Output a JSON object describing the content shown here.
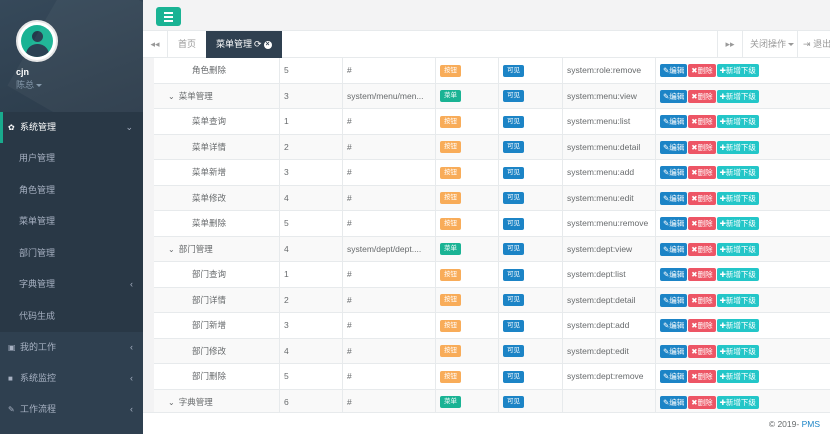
{
  "user": {
    "name": "cjn",
    "role": "陈总"
  },
  "sidebar": {
    "system_menu": {
      "label": "系统管理",
      "icon": "gear-icon"
    },
    "sub_items": [
      {
        "label": "用户管理"
      },
      {
        "label": "角色管理"
      },
      {
        "label": "菜单管理"
      },
      {
        "label": "部门管理"
      },
      {
        "label": "字典管理"
      },
      {
        "label": "代码生成"
      }
    ],
    "my_work": {
      "label": "我的工作",
      "icon": "briefcase-icon"
    },
    "monitor": {
      "label": "系统监控",
      "icon": "video-icon"
    },
    "workflow": {
      "label": "工作流程",
      "icon": "wrench-icon"
    }
  },
  "tabs": {
    "home": "首页",
    "active": "菜单管理",
    "close_ops": "关闭操作",
    "exit": "退出"
  },
  "table": {
    "rows": [
      {
        "name": "角色删除",
        "level": "child",
        "order": "5",
        "url": "#",
        "type": "按钮",
        "type_kind": "button",
        "visible": "可见",
        "perm": "system:role:remove"
      },
      {
        "name": "菜单管理",
        "level": "parent",
        "order": "3",
        "url": "system/menu/men...",
        "type": "菜单",
        "type_kind": "menu",
        "visible": "可见",
        "perm": "system:menu:view"
      },
      {
        "name": "菜单查询",
        "level": "child",
        "order": "1",
        "url": "#",
        "type": "按钮",
        "type_kind": "button",
        "visible": "可见",
        "perm": "system:menu:list"
      },
      {
        "name": "菜单详情",
        "level": "child",
        "order": "2",
        "url": "#",
        "type": "按钮",
        "type_kind": "button",
        "visible": "可见",
        "perm": "system:menu:detail"
      },
      {
        "name": "菜单新增",
        "level": "child",
        "order": "3",
        "url": "#",
        "type": "按钮",
        "type_kind": "button",
        "visible": "可见",
        "perm": "system:menu:add"
      },
      {
        "name": "菜单修改",
        "level": "child",
        "order": "4",
        "url": "#",
        "type": "按钮",
        "type_kind": "button",
        "visible": "可见",
        "perm": "system:menu:edit"
      },
      {
        "name": "菜单删除",
        "level": "child",
        "order": "5",
        "url": "#",
        "type": "按钮",
        "type_kind": "button",
        "visible": "可见",
        "perm": "system:menu:remove"
      },
      {
        "name": "部门管理",
        "level": "parent",
        "order": "4",
        "url": "system/dept/dept....",
        "type": "菜单",
        "type_kind": "menu",
        "visible": "可见",
        "perm": "system:dept:view"
      },
      {
        "name": "部门查询",
        "level": "child",
        "order": "1",
        "url": "#",
        "type": "按钮",
        "type_kind": "button",
        "visible": "可见",
        "perm": "system:dept:list"
      },
      {
        "name": "部门详情",
        "level": "child",
        "order": "2",
        "url": "#",
        "type": "按钮",
        "type_kind": "button",
        "visible": "可见",
        "perm": "system:dept:detail"
      },
      {
        "name": "部门新增",
        "level": "child",
        "order": "3",
        "url": "#",
        "type": "按钮",
        "type_kind": "button",
        "visible": "可见",
        "perm": "system:dept:add"
      },
      {
        "name": "部门修改",
        "level": "child",
        "order": "4",
        "url": "#",
        "type": "按钮",
        "type_kind": "button",
        "visible": "可见",
        "perm": "system:dept:edit"
      },
      {
        "name": "部门删除",
        "level": "child",
        "order": "5",
        "url": "#",
        "type": "按钮",
        "type_kind": "button",
        "visible": "可见",
        "perm": "system:dept:remove"
      },
      {
        "name": "字典管理",
        "level": "parent",
        "order": "6",
        "url": "#",
        "type": "菜单",
        "type_kind": "menu",
        "visible": "可见",
        "perm": ""
      }
    ],
    "actions": {
      "edit": "编辑",
      "delete": "删除",
      "add_child": "新增下级"
    }
  },
  "footer": {
    "copyright": "© 2019-",
    "brand": "PMS"
  },
  "colors": {
    "sidebar_bg": "#2f4050",
    "accent": "#1ab394",
    "primary": "#1c84c6",
    "danger": "#ed5565",
    "warning": "#f8ac59",
    "info": "#23c6c8"
  }
}
